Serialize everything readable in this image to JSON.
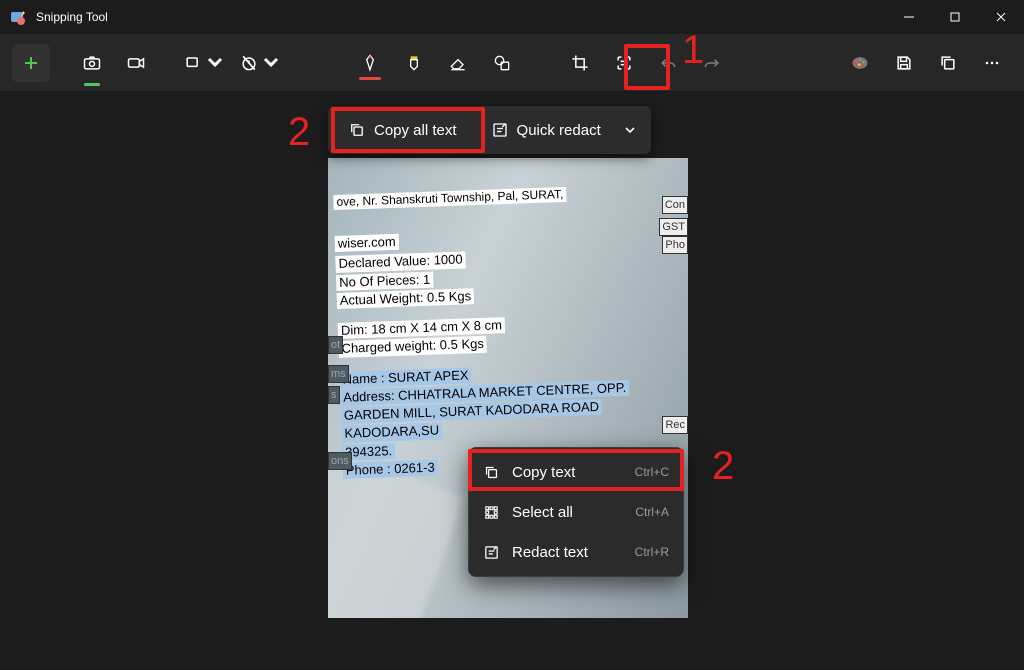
{
  "window": {
    "title": "Snipping Tool"
  },
  "toolbar": {
    "copy_all_text": "Copy all text",
    "quick_redact": "Quick redact"
  },
  "context_menu": {
    "copy_text": "Copy text",
    "copy_text_kbd": "Ctrl+C",
    "select_all": "Select all",
    "select_all_kbd": "Ctrl+A",
    "redact_text": "Redact text",
    "redact_text_kbd": "Ctrl+R"
  },
  "annotations": {
    "n1": "1",
    "n2a": "2",
    "n2b": "2"
  },
  "photo_text": {
    "line1": "ove, Nr. Shanskruti Township, Pal, SURAT,",
    "line2": "wiser.com",
    "declared": "Declared Value: 1000",
    "pieces": "No Of Pieces: 1",
    "weight": "Actual Weight: 0.5 Kgs",
    "dim": "Dim: 18 cm X 14 cm X 8 cm",
    "charged": "Charged weight: 0.5 Kgs",
    "name": "Name : SURAT APEX",
    "addr1": "Address: CHHATRALA MARKET CENTRE, OPP.",
    "addr2": "GARDEN MILL, SURAT KADODARA ROAD",
    "addr3": "KADODARA,SU",
    "pin": "394325.",
    "phone": "Phone : 0261-3",
    "side_ot": "ot",
    "side_ms": "ms",
    "side_s": "s",
    "side_ons": "ons",
    "side_rec": "Rec",
    "side_con": "Con",
    "side_gst": "GST",
    "side_pho": "Pho"
  }
}
